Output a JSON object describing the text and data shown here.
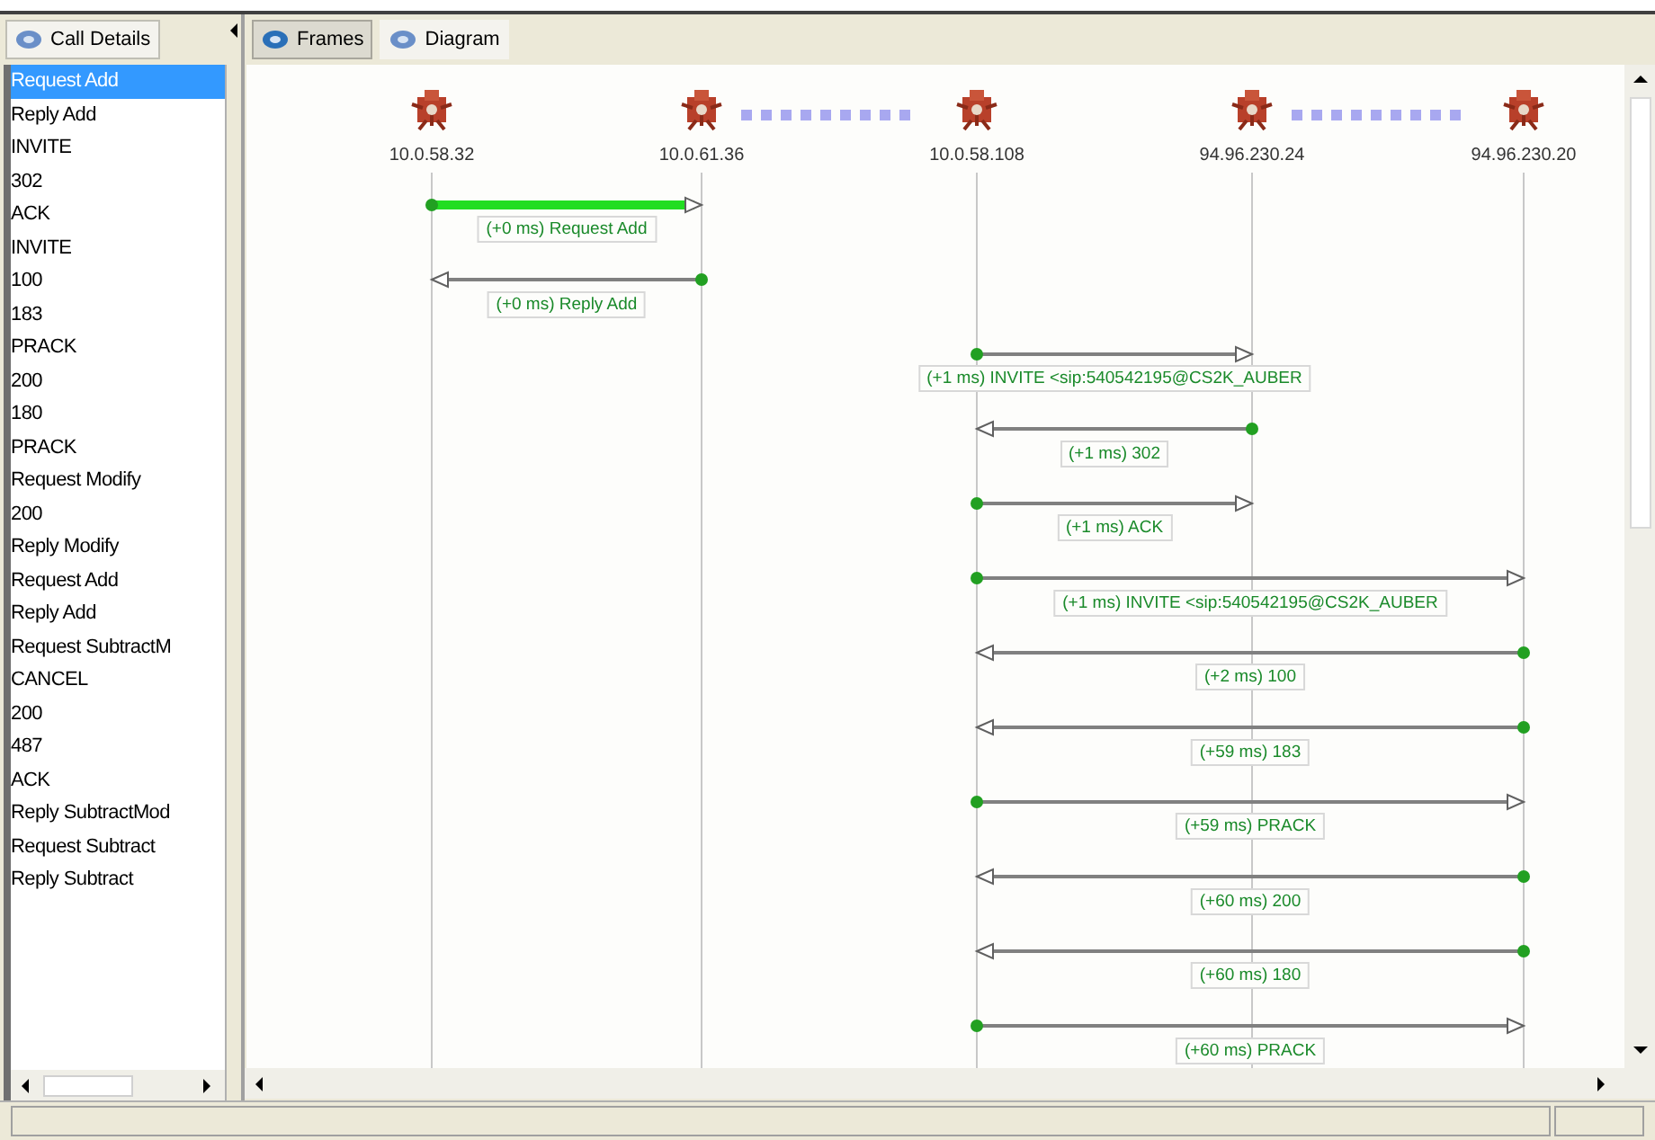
{
  "left_tab": {
    "label": "Call Details"
  },
  "call_list": [
    {
      "label": "Request Add",
      "selected": true
    },
    {
      "label": "Reply Add",
      "selected": false
    },
    {
      "label": "INVITE",
      "selected": false
    },
    {
      "label": "302",
      "selected": false
    },
    {
      "label": "ACK",
      "selected": false
    },
    {
      "label": "INVITE",
      "selected": false
    },
    {
      "label": "100",
      "selected": false
    },
    {
      "label": "183",
      "selected": false
    },
    {
      "label": "PRACK",
      "selected": false
    },
    {
      "label": "200",
      "selected": false
    },
    {
      "label": "180",
      "selected": false
    },
    {
      "label": "PRACK",
      "selected": false
    },
    {
      "label": "Request Modify",
      "selected": false
    },
    {
      "label": "200",
      "selected": false
    },
    {
      "label": "Reply Modify",
      "selected": false
    },
    {
      "label": "Request Add",
      "selected": false
    },
    {
      "label": "Reply Add",
      "selected": false
    },
    {
      "label": "Request SubtractM",
      "selected": false
    },
    {
      "label": "CANCEL",
      "selected": false
    },
    {
      "label": "200",
      "selected": false
    },
    {
      "label": "487",
      "selected": false
    },
    {
      "label": "ACK",
      "selected": false
    },
    {
      "label": "Reply SubtractMod",
      "selected": false
    },
    {
      "label": "Request Subtract",
      "selected": false
    },
    {
      "label": "Reply Subtract",
      "selected": false
    }
  ],
  "tabs": [
    {
      "label": "Frames",
      "selected": true
    },
    {
      "label": "Diagram",
      "selected": false
    }
  ],
  "hosts": [
    {
      "label": "10.0.58.32",
      "linked_to_next": false
    },
    {
      "label": "10.0.61.36",
      "linked_to_next": true
    },
    {
      "label": "10.0.58.108",
      "linked_to_next": false
    },
    {
      "label": "94.96.230.24",
      "linked_to_next": true
    },
    {
      "label": "94.96.230.20",
      "linked_to_next": false
    }
  ],
  "messages": [
    {
      "kind": "rightward",
      "label": "(+0 ms) Request Add",
      "selected": true
    },
    {
      "kind": "leftward",
      "label": "(+0 ms) Reply Add",
      "selected": false
    },
    {
      "kind": "rightward",
      "label": "(+1 ms) INVITE <sip:540542195@CS2K_AUBER",
      "selected": false
    },
    {
      "kind": "leftward",
      "label": "(+1 ms) 302",
      "selected": false
    },
    {
      "kind": "rightward",
      "label": "(+1 ms) ACK",
      "selected": false
    },
    {
      "kind": "rightward",
      "label": "(+1 ms) INVITE <sip:540542195@CS2K_AUBER",
      "selected": false
    },
    {
      "kind": "leftward",
      "label": "(+2 ms) 100",
      "selected": false
    },
    {
      "kind": "leftward",
      "label": "(+59 ms) 183",
      "selected": false
    },
    {
      "kind": "rightward",
      "label": "(+59 ms) PRACK",
      "selected": false
    },
    {
      "kind": "leftward",
      "label": "(+60 ms) 200",
      "selected": false
    },
    {
      "kind": "leftward",
      "label": "(+60 ms) 180",
      "selected": false
    },
    {
      "kind": "rightward",
      "label": "(+60 ms) PRACK",
      "selected": false
    }
  ]
}
